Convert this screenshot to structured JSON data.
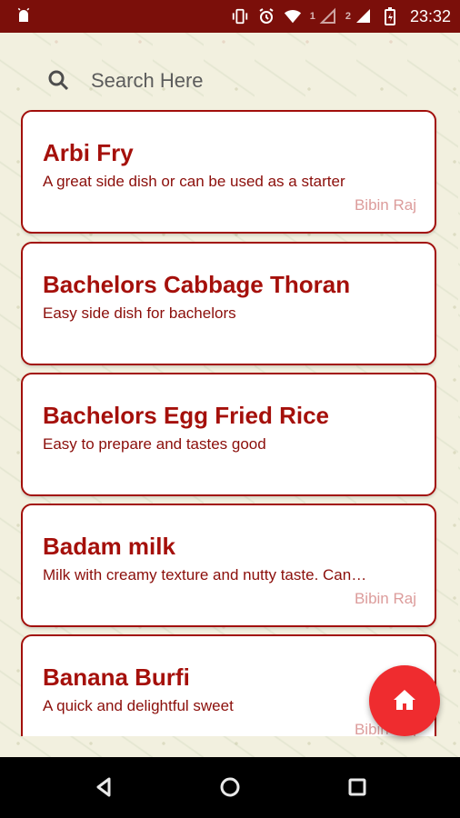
{
  "colors": {
    "status_bar": "#7b0f0a",
    "accent": "#a5100b",
    "author": "#dc9c9b",
    "fab": "#ef2c2f"
  },
  "status_bar": {
    "icons": [
      "android-icon",
      "vibrate-icon",
      "alarm-icon",
      "wifi-icon",
      "sim-signal-icon",
      "battery-icon"
    ],
    "sim_1": "1",
    "sim_2": "2",
    "time": "23:32"
  },
  "search": {
    "placeholder": "Search Here"
  },
  "recipes": [
    {
      "title": "Arbi Fry",
      "description": "A great side dish or can be used as a starter",
      "author": "Bibin Raj"
    },
    {
      "title": "Bachelors Cabbage Thoran",
      "description": "Easy side dish for bachelors",
      "author": ""
    },
    {
      "title": "Bachelors Egg Fried Rice",
      "description": "Easy to prepare and tastes good",
      "author": ""
    },
    {
      "title": "Badam milk",
      "description": "Milk with creamy texture and nutty taste. Can…",
      "author": "Bibin Raj"
    },
    {
      "title": "Banana Burfi",
      "description": "A quick and delightful sweet",
      "author": "Bibin Raj"
    }
  ],
  "fab": {
    "icon": "home-icon"
  },
  "navigation": {
    "icons": [
      "back-icon",
      "home-circle-icon",
      "recent-apps-icon"
    ]
  }
}
